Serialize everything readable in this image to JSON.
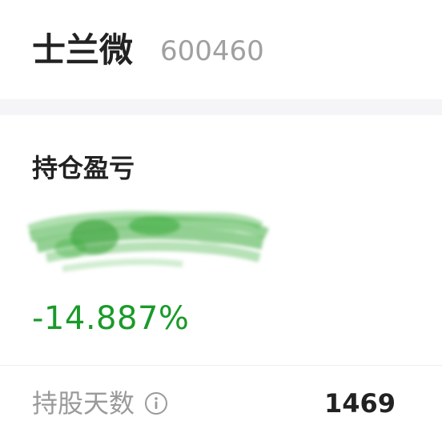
{
  "header": {
    "stock_name": "士兰微",
    "stock_code": "600460"
  },
  "pnl": {
    "label": "持仓盈亏",
    "amount_state": "obscured by green scribble",
    "percent": "-14.887%"
  },
  "holding_days": {
    "label": "持股天数",
    "info_icon": "info-icon",
    "value": "1469"
  },
  "colors": {
    "loss_green": "#1a9a2a",
    "text_dark": "#222222",
    "text_gray": "#9a9a9a",
    "code_gray": "#a0a0a0",
    "band_gray": "#f5f5f7"
  }
}
